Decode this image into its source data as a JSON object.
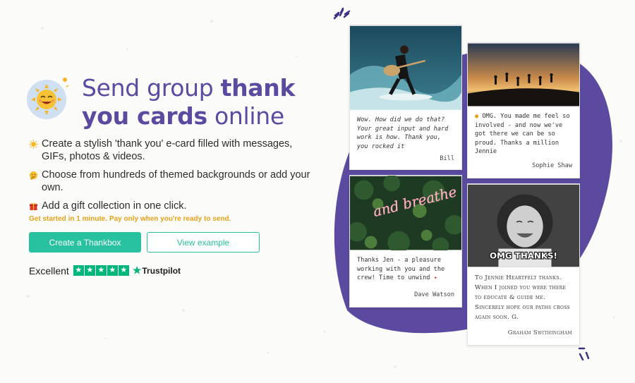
{
  "colors": {
    "brand_purple": "#5b4aa0",
    "accent_teal": "#28c2a0",
    "tagline_orange": "#e6a21a",
    "trustpilot_green": "#00b67a",
    "blob_purple": "#5b4aa0"
  },
  "hero": {
    "logo_icon": "smiling-sun-icon",
    "headline": {
      "part1": "Send group ",
      "bold1": "thank you cards",
      "part2": " online"
    },
    "features": [
      {
        "icon": "sun-emoji-icon",
        "text": "Create a stylish 'thank you' e-card filled with messages, GIFs, photos & videos."
      },
      {
        "icon": "thinking-face-emoji-icon",
        "text": "Choose from hundreds of themed backgrounds or add your own."
      },
      {
        "icon": "gift-emoji-icon",
        "text": "Add a gift collection in one click."
      }
    ],
    "tagline": "Get started in 1 minute. Pay only when you're ready to send.",
    "cta_primary": "Create a Thankbox",
    "cta_secondary": "View example",
    "trustpilot": {
      "label": "Excellent",
      "stars": 5,
      "brand": "Trustpilot"
    }
  },
  "cards": [
    {
      "image": "guitarist-surfing-wave-photo",
      "message": "Wow. How did we do that? Your great input and hard work is how. Thank you, you rocked it",
      "signature": "Bill"
    },
    {
      "image": "people-jumping-sunset-photo",
      "message": "OMG. You made me feel so involved - and now we've got there we can be so proud. Thanks a million Jennie",
      "signature": "Sophie Shaw"
    },
    {
      "image": "neon-and-breathe-sign-photo",
      "image_text": "and breathe",
      "message": "Thanks Jen - a pleasure working with you and the crew! Time to unwind",
      "signature": "Dave Watson"
    },
    {
      "image": "laughing-child-bw-photo",
      "image_text": "OMG THANKS!",
      "message": "To Jennie Heartfelt thanks. When I joined you were there to educate & guide me. Sincerely hope our paths cross again soon. G.",
      "signature": "Graham Swithingham"
    }
  ]
}
